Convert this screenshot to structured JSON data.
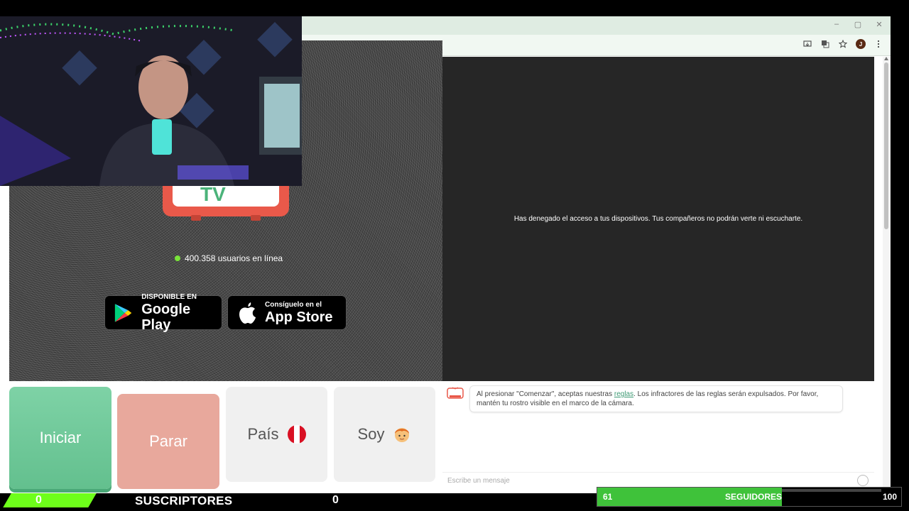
{
  "window_controls": {
    "minimize": "–",
    "restore": "▢",
    "close": "✕"
  },
  "toolbar": {
    "profile_initial": "J"
  },
  "home": {
    "online_text": "400.358 usuarios en línea",
    "logo_text": "TV",
    "google_play": {
      "small": "DISPONIBLE EN",
      "big": "Google Play"
    },
    "app_store": {
      "small": "Consíguelo en el",
      "big": "App Store"
    }
  },
  "camera": {
    "message": "Has denegado el acceso a tus dispositivos. Tus compañeros no podrán verte ni escucharte."
  },
  "buttons": {
    "start": "Iniciar",
    "stop": "Parar",
    "country": "País",
    "gender": "Soy"
  },
  "chat": {
    "message_before": "Al presionar \"Comenzar\", aceptas nuestras ",
    "message_link": "reglas",
    "message_after": ". Los infractores de las reglas serán expulsados. Por favor, mantén tu rostro visible en el marco de la cámara.",
    "input_placeholder": "Escribe un mensaje"
  },
  "stream_overlay": {
    "subscribers": {
      "left_value": "0",
      "label": "SUSCRIPTORES",
      "right_value": "0"
    },
    "followers": {
      "current": "61",
      "label": "SEGUIDORES",
      "goal": "100"
    }
  },
  "colors": {
    "start_green": "#6cc795",
    "stop_red": "#e8a89c",
    "accent_link": "#3e9a74",
    "online_dot": "#79e33a",
    "sub_bar_green": "#6eff1a",
    "follower_green": "#3fc23a"
  }
}
